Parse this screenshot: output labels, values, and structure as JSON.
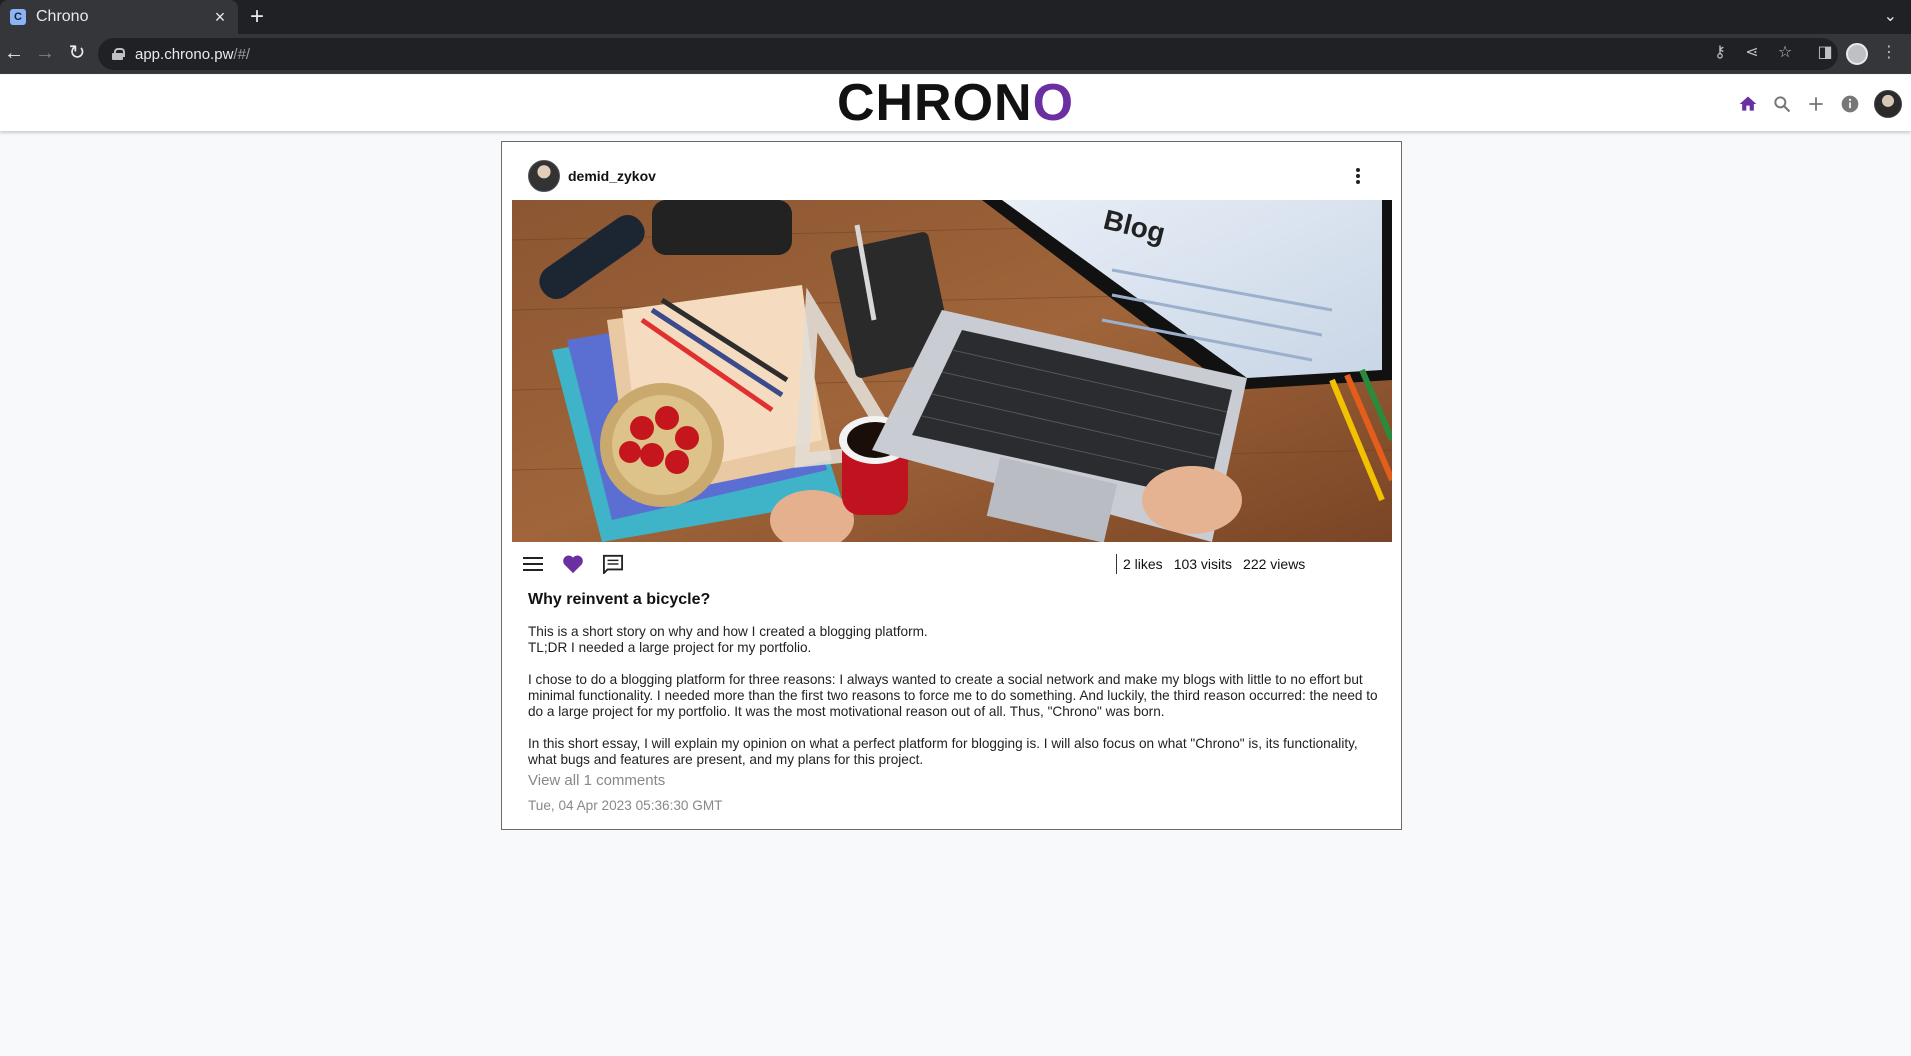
{
  "browser": {
    "tab_title": "Chrono",
    "favicon_letter": "C",
    "url_host": "app.chrono.pw",
    "url_path": "/#/"
  },
  "app": {
    "logo_main": "CHRON",
    "logo_accent": "O",
    "accent_color": "#6a2fa0",
    "nav_icons": [
      "home-icon",
      "search-icon",
      "add-icon",
      "info-icon",
      "profile-avatar"
    ]
  },
  "post": {
    "username": "demid_zykov",
    "stats": {
      "likes": "2 likes",
      "visits": "103 visits",
      "views": "222 views"
    },
    "title": "Why reinvent a bicycle?",
    "paragraphs": [
      "This is a short story on why and how I created a blogging platform.",
      "TL;DR I needed a large project for my portfolio.",
      "I chose to do a blogging platform for three reasons: I always wanted to create a social network and make my blogs with little to no effort but minimal functionality. I needed more than the first two reasons to force me to do something. And luckily, the third reason occurred: the need to do a large project for my portfolio. It was the most motivational reason out of all. Thus, \"Chrono\" was born.",
      "In this short essay, I will explain my opinion on what a perfect platform for blogging is. I will also focus on what \"Chrono\" is, its functionality, what bugs and features are present, and my plans for this project."
    ],
    "view_comments": "View all 1 comments",
    "date": "Tue, 04 Apr 2023 05:36:30 GMT",
    "image_text": "Blog"
  }
}
